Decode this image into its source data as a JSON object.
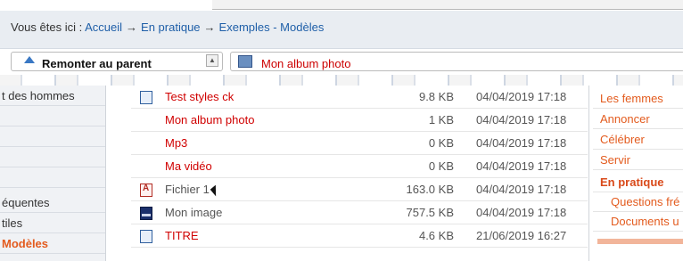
{
  "breadcrumb": {
    "prefix": "Vous êtes ici :",
    "items": [
      "Accueil",
      "En pratique",
      "Exemples - Modèles"
    ],
    "separator": "→"
  },
  "toolbar": {
    "up_label": "Remonter au parent",
    "album_label": "Mon album photo"
  },
  "left_nav": {
    "items": [
      {
        "label": "t des hommes",
        "active": false
      },
      {
        "label": "",
        "active": false
      },
      {
        "label": "",
        "active": false
      },
      {
        "label": "",
        "active": false
      },
      {
        "label": "",
        "active": false
      },
      {
        "label": "équentes",
        "active": false
      },
      {
        "label": "tiles",
        "active": false
      },
      {
        "label": "Modèles",
        "active": true
      }
    ]
  },
  "files": {
    "rows": [
      {
        "name": "Test styles ck",
        "size": "9.8 KB",
        "date": "04/04/2019 17:18",
        "icon": "document-icon",
        "color": "#d00000"
      },
      {
        "name": "Mon album photo",
        "size": "1 KB",
        "date": "04/04/2019 17:18",
        "icon": "",
        "color": "#d00000"
      },
      {
        "name": "Mp3",
        "size": "0 KB",
        "date": "04/04/2019 17:18",
        "icon": "",
        "color": "#d00000"
      },
      {
        "name": "Ma vidéo",
        "size": "0 KB",
        "date": "04/04/2019 17:18",
        "icon": "",
        "color": "#d00000"
      },
      {
        "name": "Fichier 1",
        "size": "163.0 KB",
        "date": "04/04/2019 17:18",
        "icon": "pdf-icon",
        "color": "#555555"
      },
      {
        "name": "Mon image",
        "size": "757.5 KB",
        "date": "04/04/2019 17:18",
        "icon": "image-icon",
        "color": "#555555"
      },
      {
        "name": "TITRE",
        "size": "4.6 KB",
        "date": "21/06/2019 16:27",
        "icon": "document-icon",
        "color": "#d00000"
      }
    ]
  },
  "right_nav": {
    "items": [
      {
        "label": "Les femmes",
        "sub": false,
        "bold": false
      },
      {
        "label": "Annoncer",
        "sub": false,
        "bold": false
      },
      {
        "label": "Célébrer",
        "sub": false,
        "bold": false
      },
      {
        "label": "Servir",
        "sub": false,
        "bold": false
      },
      {
        "label": "En pratique",
        "sub": false,
        "bold": true
      },
      {
        "label": "Questions fré",
        "sub": true,
        "bold": false
      },
      {
        "label": "Documents u",
        "sub": true,
        "bold": false
      }
    ]
  },
  "colors": {
    "link": "#1f5fa8",
    "accent": "#e35b1e",
    "file_red": "#d00000"
  }
}
